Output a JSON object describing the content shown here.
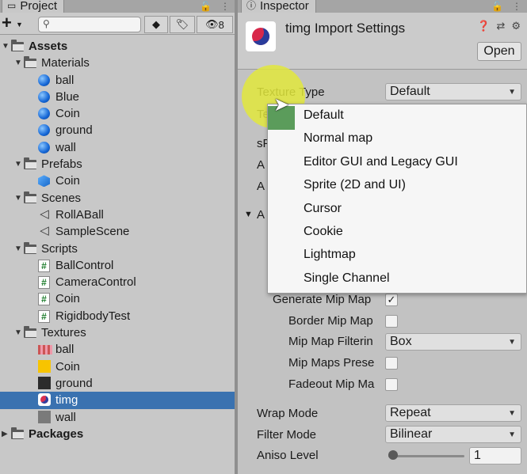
{
  "project": {
    "tab_label": "Project",
    "hidden_count": "8",
    "search": {
      "placeholder": ""
    },
    "tree": [
      {
        "label": "Assets",
        "level": 0,
        "kind": "folder",
        "expanded": true,
        "bold": true
      },
      {
        "label": "Materials",
        "level": 1,
        "kind": "folder",
        "expanded": true
      },
      {
        "label": "ball",
        "level": 2,
        "kind": "material"
      },
      {
        "label": "Blue",
        "level": 2,
        "kind": "material"
      },
      {
        "label": "Coin",
        "level": 2,
        "kind": "material"
      },
      {
        "label": "ground",
        "level": 2,
        "kind": "material"
      },
      {
        "label": "wall",
        "level": 2,
        "kind": "material"
      },
      {
        "label": "Prefabs",
        "level": 1,
        "kind": "folder",
        "expanded": true
      },
      {
        "label": "Coin",
        "level": 2,
        "kind": "prefab"
      },
      {
        "label": "Scenes",
        "level": 1,
        "kind": "folder",
        "expanded": true
      },
      {
        "label": "RollABall",
        "level": 2,
        "kind": "scene"
      },
      {
        "label": "SampleScene",
        "level": 2,
        "kind": "scene"
      },
      {
        "label": "Scripts",
        "level": 1,
        "kind": "folder",
        "expanded": true
      },
      {
        "label": "BallControl",
        "level": 2,
        "kind": "script"
      },
      {
        "label": "CameraControl",
        "level": 2,
        "kind": "script"
      },
      {
        "label": "Coin",
        "level": 2,
        "kind": "script"
      },
      {
        "label": "RigidbodyTest",
        "level": 2,
        "kind": "script"
      },
      {
        "label": "Textures",
        "level": 1,
        "kind": "folder",
        "expanded": true
      },
      {
        "label": "ball",
        "level": 2,
        "kind": "tex-ball"
      },
      {
        "label": "Coin",
        "level": 2,
        "kind": "tex-coin"
      },
      {
        "label": "ground",
        "level": 2,
        "kind": "tex-ground"
      },
      {
        "label": "timg",
        "level": 2,
        "kind": "tex-timg",
        "selected": true
      },
      {
        "label": "wall",
        "level": 2,
        "kind": "tex-wall"
      },
      {
        "label": "Packages",
        "level": 0,
        "kind": "folder",
        "expanded": false,
        "bold": true
      }
    ]
  },
  "inspector": {
    "tab_label": "Inspector",
    "title": "timg Import Settings",
    "open_label": "Open",
    "texture_type_label": "Texture Type",
    "texture_type_value": "Default",
    "hidden_row_fragments": [
      "Te",
      "sF",
      "A",
      "A",
      "A"
    ],
    "generate_mip_label": "Generate Mip Map",
    "generate_mip_checked": true,
    "border_mip_label": "Border Mip Map",
    "mip_filter_label": "Mip Map Filterin",
    "mip_filter_value": "Box",
    "mip_preserve_label": "Mip Maps Prese",
    "fadeout_label": "Fadeout Mip Ma",
    "wrap_mode_label": "Wrap Mode",
    "wrap_mode_value": "Repeat",
    "filter_mode_label": "Filter Mode",
    "filter_mode_value": "Bilinear",
    "aniso_label": "Aniso Level",
    "aniso_value": "1",
    "aniso_slider_fraction": 0.0
  },
  "dropdown": {
    "options": [
      "Default",
      "Normal map",
      "Editor GUI and Legacy GUI",
      "Sprite (2D and UI)",
      "Cursor",
      "Cookie",
      "Lightmap",
      "Single Channel"
    ],
    "selected": "Default"
  },
  "colors": {
    "selection": "#3a72b0",
    "material_blue": "#1466d6",
    "highlight": "#e2e83c"
  }
}
